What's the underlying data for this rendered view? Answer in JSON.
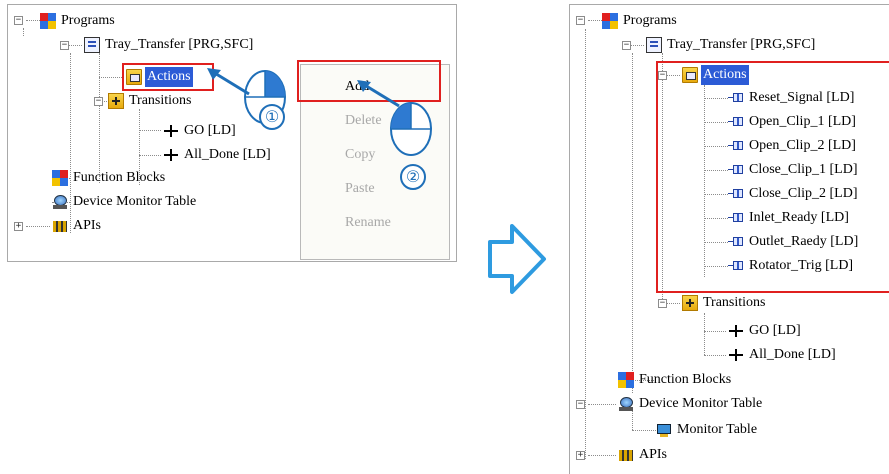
{
  "left_tree": {
    "programs": "Programs",
    "pou": "Tray_Transfer [PRG,SFC]",
    "actions": "Actions",
    "transitions": "Transitions",
    "go": "GO [LD]",
    "all_done": "All_Done [LD]",
    "function_blocks": "Function Blocks",
    "device_monitor_table": "Device Monitor Table",
    "apis": "APIs"
  },
  "context_menu": {
    "add": "Add",
    "delete": "Delete",
    "copy": "Copy",
    "paste": "Paste",
    "rename": "Rename"
  },
  "steps": {
    "one": "①",
    "two": "②"
  },
  "right_tree": {
    "programs": "Programs",
    "pou": "Tray_Transfer [PRG,SFC]",
    "actions": "Actions",
    "action_items": [
      "Reset_Signal [LD]",
      "Open_Clip_1 [LD]",
      "Open_Clip_2 [LD]",
      "Close_Clip_1 [LD]",
      "Close_Clip_2 [LD]",
      "Inlet_Ready [LD]",
      "Outlet_Raedy [LD]",
      "Rotator_Trig [LD]"
    ],
    "transitions": "Transitions",
    "go": "GO [LD]",
    "all_done": "All_Done [LD]",
    "function_blocks": "Function Blocks",
    "device_monitor_table": "Device Monitor Table",
    "monitor_table": "Monitor Table",
    "apis": "APIs"
  },
  "colors": {
    "highlight": "#e0201f",
    "selection": "#2c5bd6",
    "arrow": "#1f6fb8",
    "mouse_blue": "#2e7ad1"
  }
}
